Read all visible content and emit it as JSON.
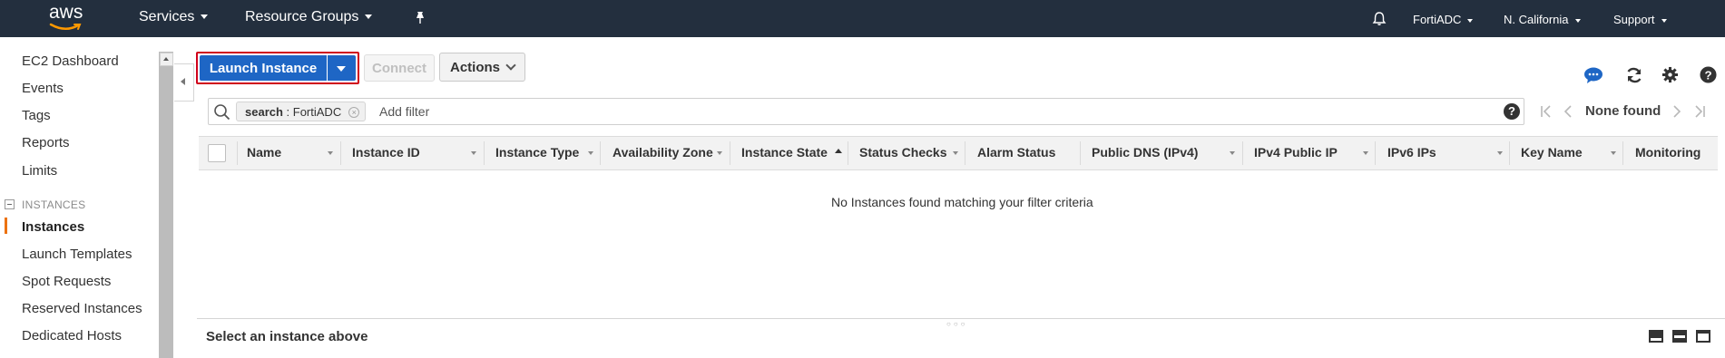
{
  "topnav": {
    "logo_text": "aws",
    "services": "Services",
    "resource_groups": "Resource Groups",
    "account": "FortiADC",
    "region": "N. California",
    "support": "Support"
  },
  "sidebar": {
    "items_top": [
      "EC2 Dashboard",
      "Events",
      "Tags",
      "Reports",
      "Limits"
    ],
    "section_header": "INSTANCES",
    "items_instances": [
      "Instances",
      "Launch Templates",
      "Spot Requests",
      "Reserved Instances",
      "Dedicated Hosts"
    ]
  },
  "toolbar": {
    "launch_label": "Launch Instance",
    "connect_label": "Connect",
    "actions_label": "Actions"
  },
  "filter": {
    "token_key": "search",
    "token_value": " : FortiADC",
    "add_filter": "Add filter",
    "help": "?",
    "result": "None found"
  },
  "table": {
    "columns": [
      "Name",
      "Instance ID",
      "Instance Type",
      "Availability Zone",
      "Instance State",
      "Status Checks",
      "Alarm Status",
      "Public DNS (IPv4)",
      "IPv4 Public IP",
      "IPv6 IPs",
      "Key Name",
      "Monitoring"
    ],
    "empty_message": "No Instances found matching your filter criteria"
  },
  "details": {
    "title": "Select an instance above"
  },
  "colors": {
    "nav_bg": "#232f3e",
    "primary": "#1e66c5",
    "highlight": "#d0021b",
    "active": "#ec7211",
    "chat_icon": "#1e66c5"
  }
}
